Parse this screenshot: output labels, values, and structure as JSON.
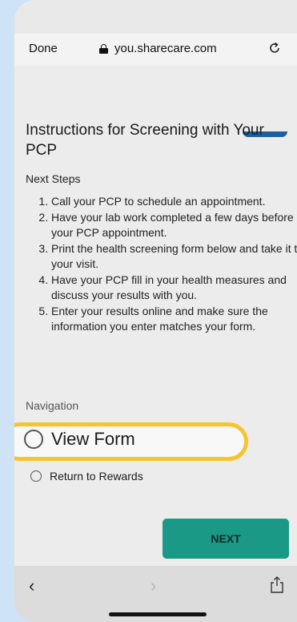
{
  "browser": {
    "done_label": "Done",
    "url": "you.sharecare.com"
  },
  "page": {
    "title": "Instructions for Screening with Your PCP",
    "subheading": "Next Steps",
    "steps": [
      "Call your PCP to schedule an appointment.",
      "Have your lab work completed a few days before your PCP appointment.",
      "Print the health screening form below and take it to your visit.",
      "Have your PCP fill in your health measures and discuss your results with you.",
      "Enter your results online and make sure the information you enter matches your form."
    ],
    "navigation_label": "Navigation",
    "options": [
      {
        "label": "View Form",
        "selected": false,
        "highlighted": true
      },
      {
        "label": "Return to Rewards",
        "selected": false
      }
    ],
    "next_label": "NEXT"
  },
  "toolbar": {
    "back_icon": "chevron-left-icon",
    "forward_icon": "chevron-right-icon",
    "share_icon": "share-icon"
  },
  "colors": {
    "accent_button": "#1a9a86",
    "highlight": "#f5c531",
    "background": "#cfe3f6"
  }
}
